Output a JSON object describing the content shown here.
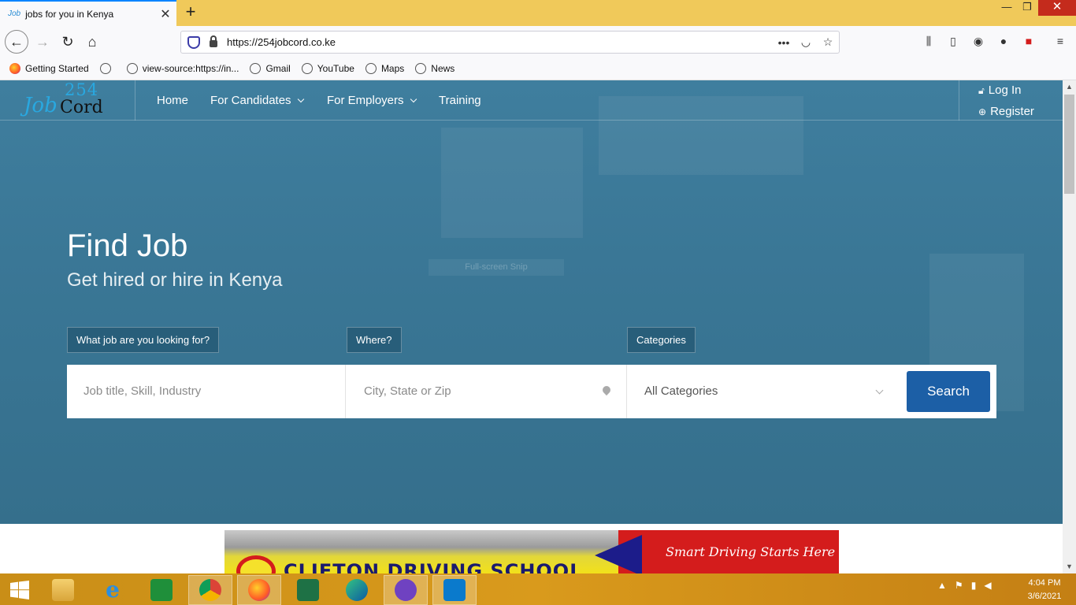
{
  "browser": {
    "tab_title": "jobs for you in Kenya",
    "tab_favicon_text": "Job",
    "url": "https://254jobcord.co.ke",
    "url_actions": [
      "•••"
    ],
    "bookmarks": [
      {
        "label": "Getting Started",
        "icon": "firefox-icon"
      },
      {
        "label": "view-source:https://in...",
        "icon": "globe-icon"
      },
      {
        "label": "Gmail",
        "icon": "globe-icon"
      },
      {
        "label": "YouTube",
        "icon": "globe-icon"
      },
      {
        "label": "Maps",
        "icon": "globe-icon"
      },
      {
        "label": "News",
        "icon": "globe-icon"
      }
    ]
  },
  "site": {
    "logo": {
      "number": "254",
      "part1": "Job",
      "part2": "Cord"
    },
    "nav": {
      "home": "Home",
      "candidates": "For Candidates",
      "employers": "For Employers",
      "training": "Training"
    },
    "auth": {
      "login": "Log In",
      "register": "Register"
    }
  },
  "hero": {
    "title": "Find Job",
    "subtitle": "Get hired or hire in Kenya",
    "overlay_text": "Full-screen Snip",
    "labels": {
      "what": "What job are you looking for?",
      "where": "Where?",
      "categories": "Categories"
    },
    "search": {
      "job_placeholder": "Job title, Skill, Industry",
      "where_placeholder": "City, State or Zip",
      "category_selected": "All Categories",
      "button": "Search"
    }
  },
  "banner": {
    "tagline": "Smart Driving Starts Here",
    "name": "CLIFTON DRIVING SCHOOL"
  },
  "taskbar": {
    "apps": [
      "windows-start",
      "file-explorer",
      "internet-explorer",
      "store",
      "chrome",
      "firefox",
      "excel",
      "edge",
      "github-desktop",
      "vscode"
    ],
    "time": "4:04 PM",
    "date": "3/6/2021"
  },
  "colors": {
    "hero": "#3a7796",
    "search_button": "#1c5fa6",
    "titlebar": "#f0c95a",
    "taskbar": "#d99a1c"
  }
}
